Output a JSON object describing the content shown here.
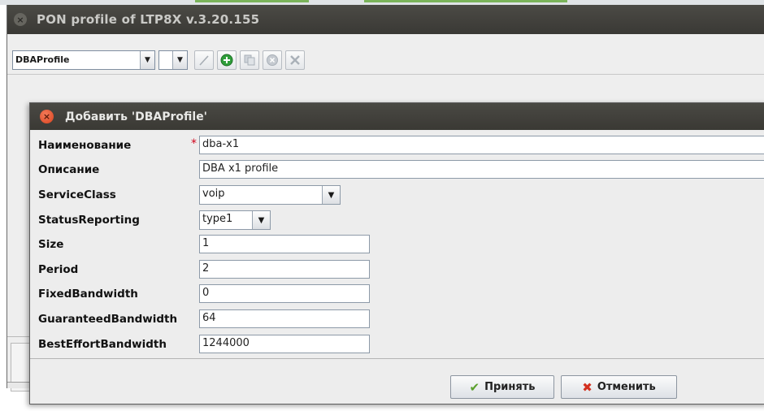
{
  "main_window": {
    "title": "PON profile of LTP8X v.3.20.155",
    "profile_type_value": "DBAProfile",
    "second_combo_value": ""
  },
  "toolbar_icons": [
    "edit-pencil-icon",
    "add-icon",
    "copy-icon",
    "delete-icon",
    "remove-x-icon"
  ],
  "dialog": {
    "title": "Добавить 'DBAProfile'",
    "fields": [
      {
        "label": "Наименование",
        "value": "dba-x1",
        "required_mark": "*"
      },
      {
        "label": "Описание",
        "value": "DBA x1 profile"
      },
      {
        "label": "ServiceClass",
        "value": "voip"
      },
      {
        "label": "StatusReporting",
        "value": "type1"
      },
      {
        "label": "Size",
        "value": "1"
      },
      {
        "label": "Period",
        "value": "2"
      },
      {
        "label": "FixedBandwidth",
        "value": "0"
      },
      {
        "label": "GuaranteedBandwidth",
        "value": "64"
      },
      {
        "label": "BestEffortBandwidth",
        "value": "1244000"
      }
    ],
    "accept_label": "Принять",
    "cancel_label": "Отменить"
  },
  "colors": {
    "titlebar": "#3f3e3a",
    "required": "#d0021b",
    "accept_icon": "#5aa02c",
    "cancel_icon": "#d3301f",
    "add_icon": "#2f9e3a"
  }
}
